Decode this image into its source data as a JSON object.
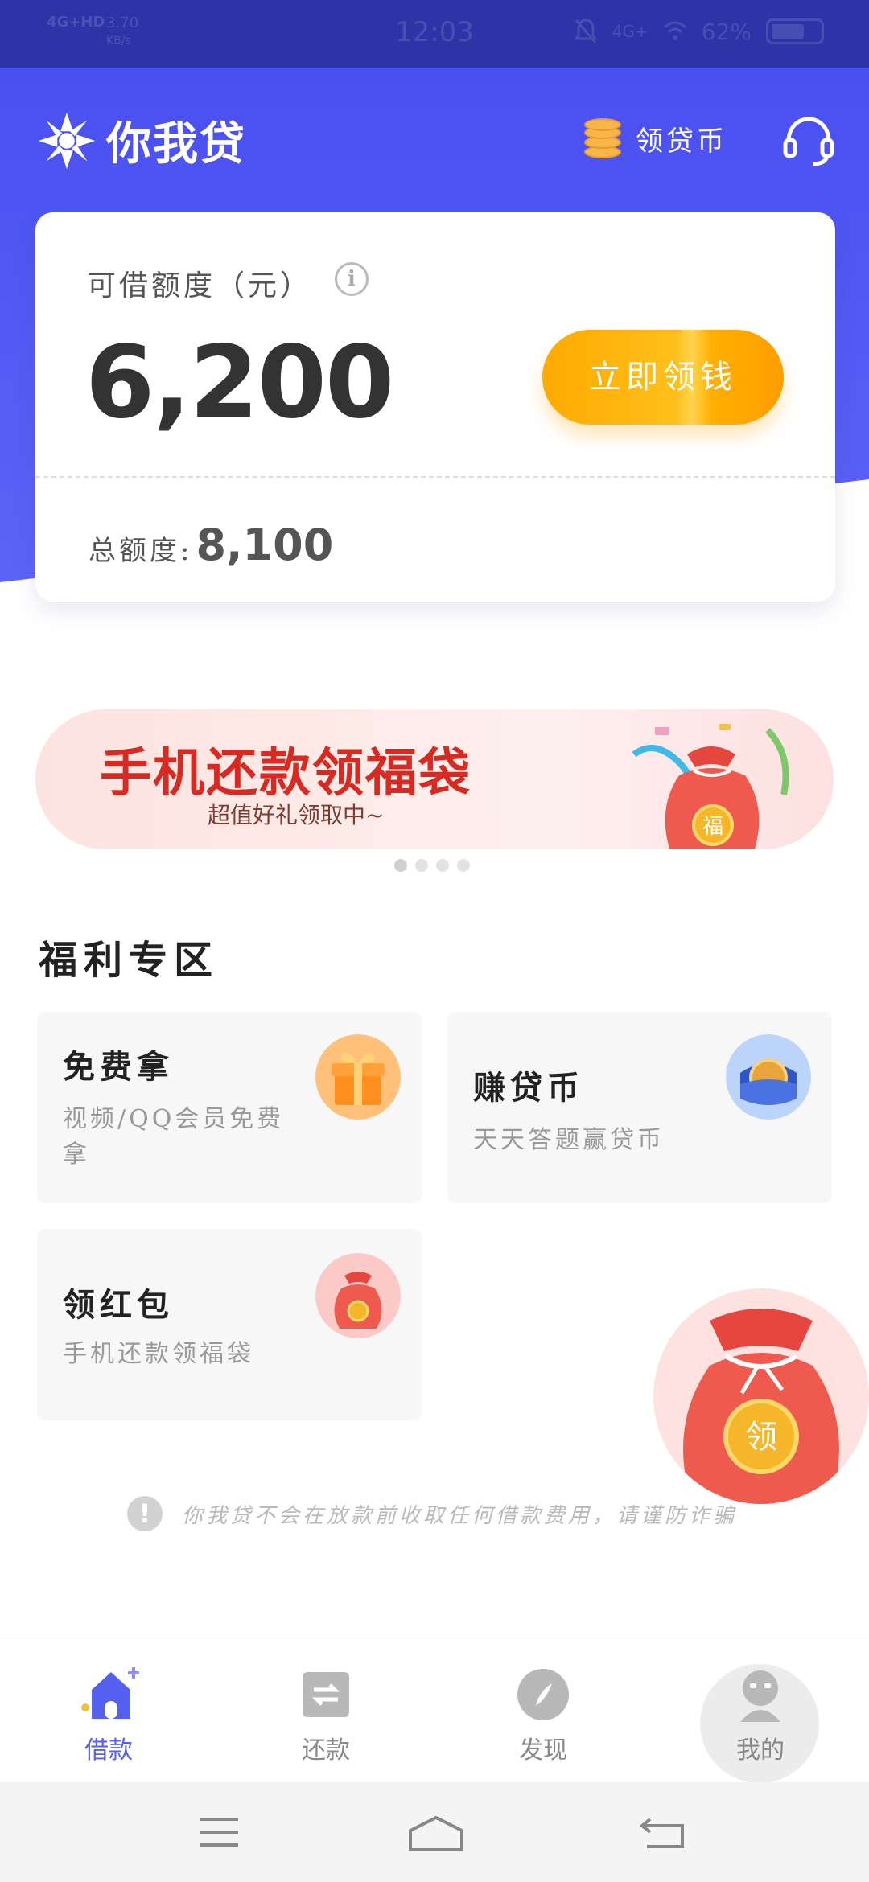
{
  "status_bar": {
    "network": "4G+HD",
    "speed": "3.70",
    "speed_unit": "KB/s",
    "time": "12:03",
    "network_right": "4G+",
    "battery": "62%"
  },
  "header": {
    "app_name": "你我贷",
    "coin_link": "领贷币"
  },
  "credit": {
    "label": "可借额度（元）",
    "info_icon": "i",
    "amount": "6,200",
    "claim_button": "立即领钱",
    "total_label": "总额度:",
    "total_value": "8,100"
  },
  "banner": {
    "title": "手机还款领福袋",
    "subtitle": "超值好礼领取中~",
    "bag_text": "福",
    "carousel_count": 4,
    "carousel_active": 1
  },
  "welfare": {
    "title": "福利专区",
    "cards": [
      {
        "title": "免费拿",
        "desc": "视频/QQ会员免费拿",
        "icon": "gift-box-icon"
      },
      {
        "title": "赚贷币",
        "desc": "天天答题赢贷币",
        "icon": "coin-wallet-icon"
      },
      {
        "title": "领红包",
        "desc": "手机还款领福袋",
        "icon": "lucky-bag-icon"
      }
    ],
    "floating_bag_text": "领"
  },
  "notice": {
    "icon": "!",
    "text": "你我贷不会在放款前收取任何借款费用，请谨防诈骗"
  },
  "tabs": [
    {
      "label": "借款",
      "icon": "home-icon",
      "active": true
    },
    {
      "label": "还款",
      "icon": "repay-icon",
      "active": false
    },
    {
      "label": "发现",
      "icon": "compass-icon",
      "active": false
    },
    {
      "label": "我的",
      "icon": "profile-icon",
      "active": false
    }
  ],
  "colors": {
    "header_blue": "#4a50f0",
    "accent_orange": "#ffaa00",
    "banner_red": "#d72a22",
    "tab_active": "#5660f0"
  }
}
